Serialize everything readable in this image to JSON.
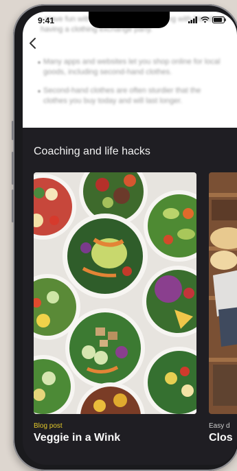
{
  "status_bar": {
    "time": "9:41"
  },
  "background_text": {
    "line_1": "• Have fun with friends - host a shopping with friends or having a clothing exchange party.",
    "line_2": "Many apps and websites let you shop online for local goods, including second-hand clothes.",
    "line_3": "Second-hand clothes are often sturdier that the clothes you buy today and will last longer."
  },
  "section": {
    "title": "Coaching and life hacks"
  },
  "cards": [
    {
      "kicker": "Blog post",
      "title": "Veggie in a Wink",
      "image_icon": "salad-bowls-image"
    },
    {
      "kicker": "Easy d",
      "title": "Clos",
      "image_icon": "clothes-shelf-image"
    }
  ],
  "colors": {
    "accent_kicker": "#e3c82a",
    "dark_bg": "#1f1e23"
  }
}
